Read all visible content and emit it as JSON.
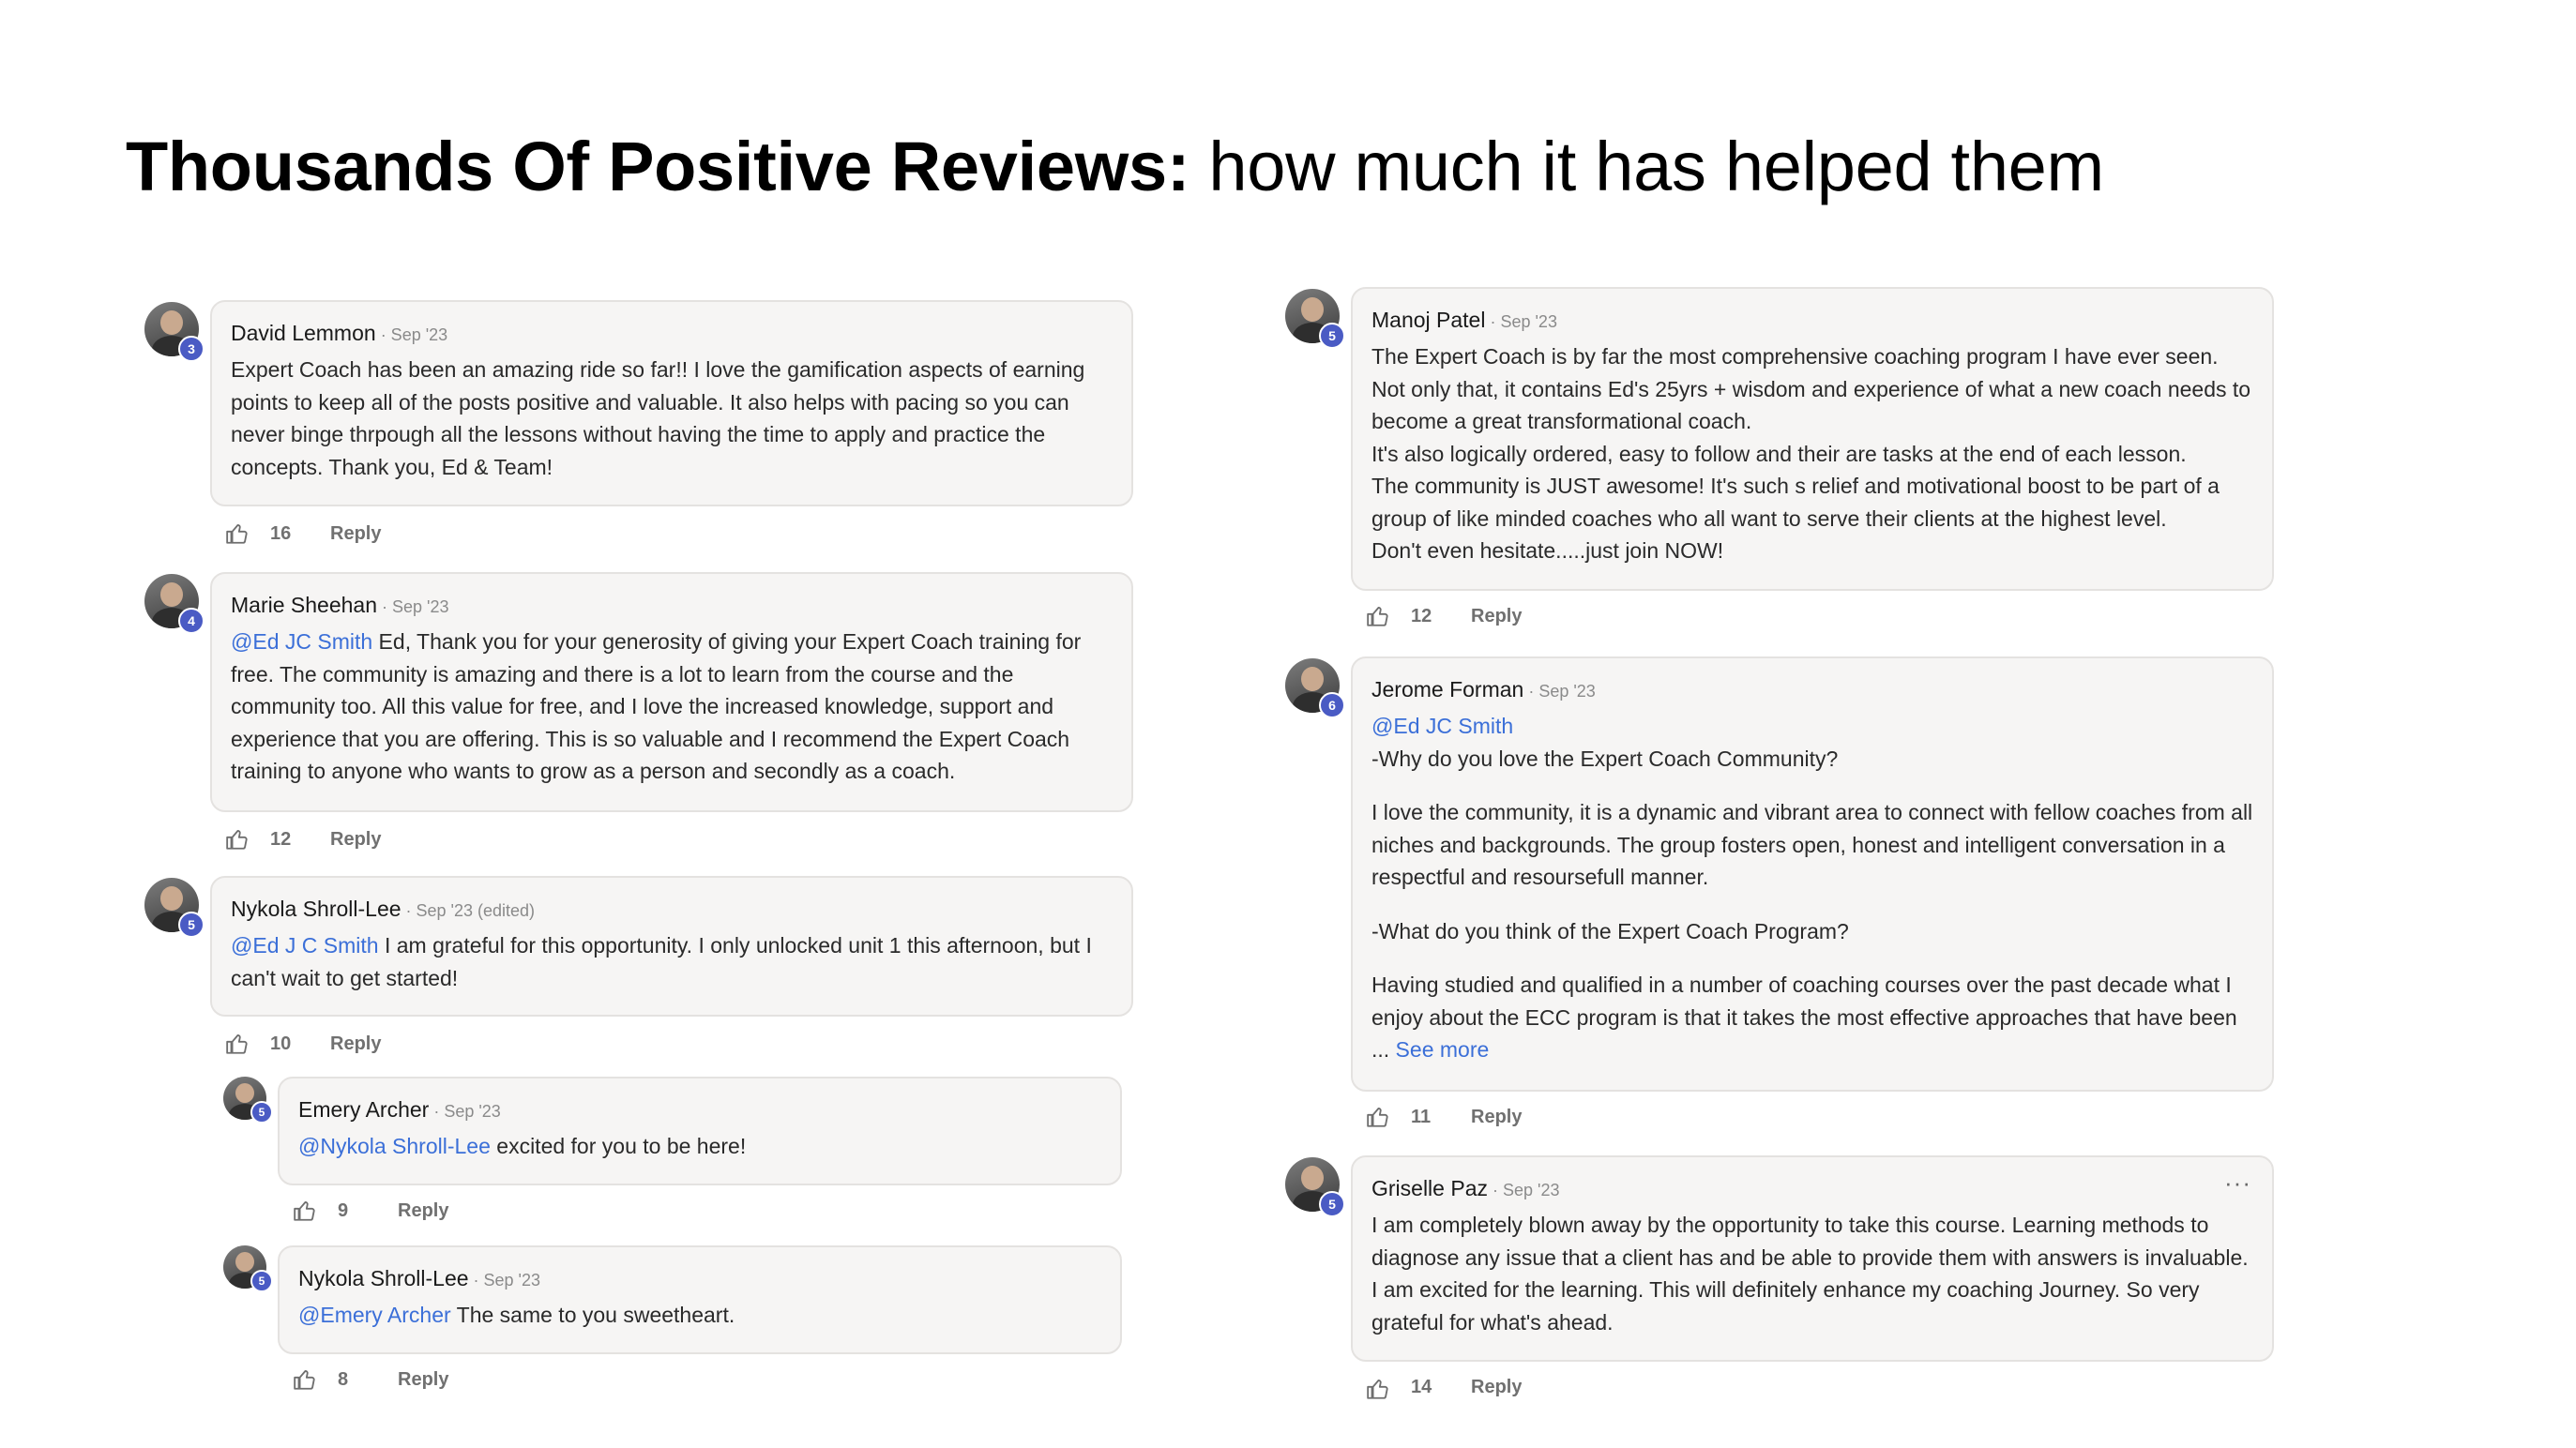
{
  "page_title": {
    "bold": "Thousands Of Positive Reviews:",
    "rest": " how much it has helped them"
  },
  "comments": {
    "c1": {
      "author": "David Lemmon",
      "meta": " · Sep '23",
      "level": "3",
      "body": "Expert Coach has been an amazing ride so far!! I love the gamification aspects of earning points to keep all of the posts positive and valuable. It also helps with pacing so you can never binge thrpough all the lessons without having the time to apply and practice the concepts. Thank you, Ed & Team!",
      "likes": "16",
      "reply": "Reply"
    },
    "c2": {
      "author": "Marie Sheehan",
      "meta": " · Sep '23",
      "level": "4",
      "mention": "@Ed JC Smith",
      "body": " Ed, Thank you for your generosity of giving your Expert Coach training for free. The community is amazing and there is a lot to learn from the course and the community too. All this value for free, and I love the increased knowledge, support and experience that you are offering. This is so valuable and I recommend the Expert Coach training to anyone who wants to grow as a person and secondly as a coach.",
      "likes": "12",
      "reply": "Reply"
    },
    "c3": {
      "author": "Nykola Shroll-Lee",
      "meta": " · Sep '23 (edited)",
      "level": "5",
      "mention": "@Ed J C Smith",
      "body": " I am grateful for this opportunity. I only unlocked unit 1 this afternoon, but I can't wait to get started!",
      "likes": "10",
      "reply": "Reply"
    },
    "c4": {
      "author": "Emery Archer",
      "meta": " · Sep '23",
      "level": "5",
      "mention": "@Nykola Shroll-Lee",
      "body": " excited for you to be here!",
      "likes": "9",
      "reply": "Reply"
    },
    "c5": {
      "author": "Nykola Shroll-Lee",
      "meta": " · Sep '23",
      "level": "5",
      "mention": "@Emery Archer",
      "body": " The same to you sweetheart.",
      "likes": "8",
      "reply": "Reply"
    },
    "c6": {
      "author": "Manoj Patel",
      "meta": " · Sep '23",
      "level": "5",
      "lines": [
        "The Expert Coach is by far the most comprehensive coaching program I have ever seen. Not only that, it contains Ed's 25yrs + wisdom and experience of what a new coach needs to become a great transformational coach.",
        "It's also logically ordered, easy to follow and their are tasks at the end of each lesson.",
        "The community is JUST awesome! It's such s relief and motivational boost to be part of a group of like minded coaches who all want to serve their clients at the highest level.",
        "Don't even hesitate.....just join NOW!"
      ],
      "likes": "12",
      "reply": "Reply"
    },
    "c7": {
      "author": "Jerome Forman",
      "meta": " · Sep '23",
      "level": "6",
      "mention": "@Ed JC Smith",
      "q1": "-Why do you love the Expert Coach Community?",
      "a1": "I love the community, it is a dynamic and vibrant area to connect with fellow coaches from all niches and backgrounds. The group fosters open, honest and intelligent conversation in a respectful and resoursefull manner.",
      "q2": "-What do you think of the Expert Coach Program?",
      "a2": "Having studied and qualified in a number of coaching courses over the past decade what I enjoy about the ECC program is that it takes the most effective approaches that have been ...",
      "see_more": " See more",
      "likes": "11",
      "reply": "Reply"
    },
    "c8": {
      "author": "Griselle Paz",
      "meta": " · Sep '23",
      "level": "5",
      "more_icon": "···",
      "body": "I am completely blown away by the opportunity to take this course. Learning methods to diagnose any issue that a client has and be able to provide them with answers is invaluable. I am excited for the learning. This will definitely enhance my coaching Journey. So very grateful for what's ahead.",
      "likes": "14",
      "reply": "Reply"
    }
  }
}
